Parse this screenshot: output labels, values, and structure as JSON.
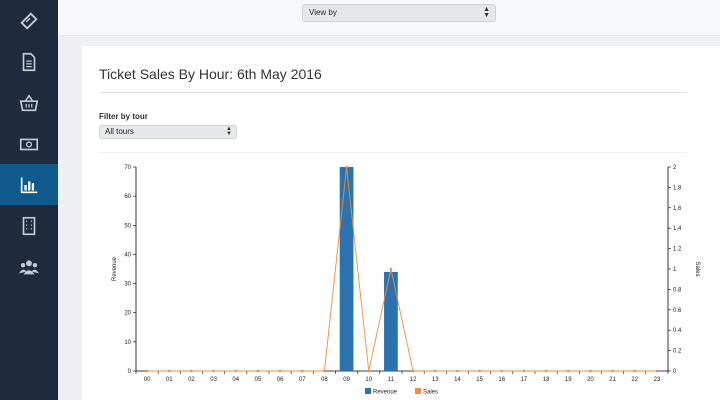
{
  "sidebar": {
    "items": [
      {
        "icon": "ticket-icon",
        "active": false
      },
      {
        "icon": "document-icon",
        "active": false
      },
      {
        "icon": "basket-icon",
        "active": false
      },
      {
        "icon": "money-icon",
        "active": false
      },
      {
        "icon": "bar-chart-icon",
        "active": true
      },
      {
        "icon": "building-icon",
        "active": false
      },
      {
        "icon": "users-icon",
        "active": false
      }
    ]
  },
  "header": {
    "view_by": "View by"
  },
  "main": {
    "title": "Ticket Sales By Hour: 6th May 2016",
    "filter_label": "Filter by tour",
    "filter_value": "All tours"
  },
  "chart_data": {
    "type": "bar",
    "categories": [
      "00",
      "01",
      "02",
      "03",
      "04",
      "05",
      "06",
      "07",
      "08",
      "09",
      "10",
      "11",
      "12",
      "13",
      "14",
      "15",
      "16",
      "17",
      "18",
      "19",
      "20",
      "21",
      "22",
      "23"
    ],
    "series": [
      {
        "name": "Revenue",
        "type": "bar",
        "axis": "left",
        "color": "#2b72b0",
        "values": [
          0,
          0,
          0,
          0,
          0,
          0,
          0,
          0,
          0,
          70,
          0,
          34,
          0,
          0,
          0,
          0,
          0,
          0,
          0,
          0,
          0,
          0,
          0,
          0
        ]
      },
      {
        "name": "Sales",
        "type": "line",
        "axis": "right",
        "color": "#f08c3a",
        "values": [
          0,
          0,
          0,
          0,
          0,
          0,
          0,
          0,
          0,
          2,
          0,
          1,
          0,
          0,
          0,
          0,
          0,
          0,
          0,
          0,
          0,
          0,
          0,
          0
        ]
      }
    ],
    "ylabel": "Revenue",
    "y2label": "Sales",
    "ylim": [
      0,
      70
    ],
    "y2lim": [
      0,
      2
    ],
    "yticks": [
      "0",
      "10",
      "20",
      "30",
      "40",
      "50",
      "60",
      "70"
    ],
    "y2ticks": [
      "0",
      "0.2",
      "0.4",
      "0.6",
      "0.8",
      "1",
      "1.2",
      "1.4",
      "1.6",
      "1.8",
      "2"
    ],
    "legend_position": "bottom"
  }
}
